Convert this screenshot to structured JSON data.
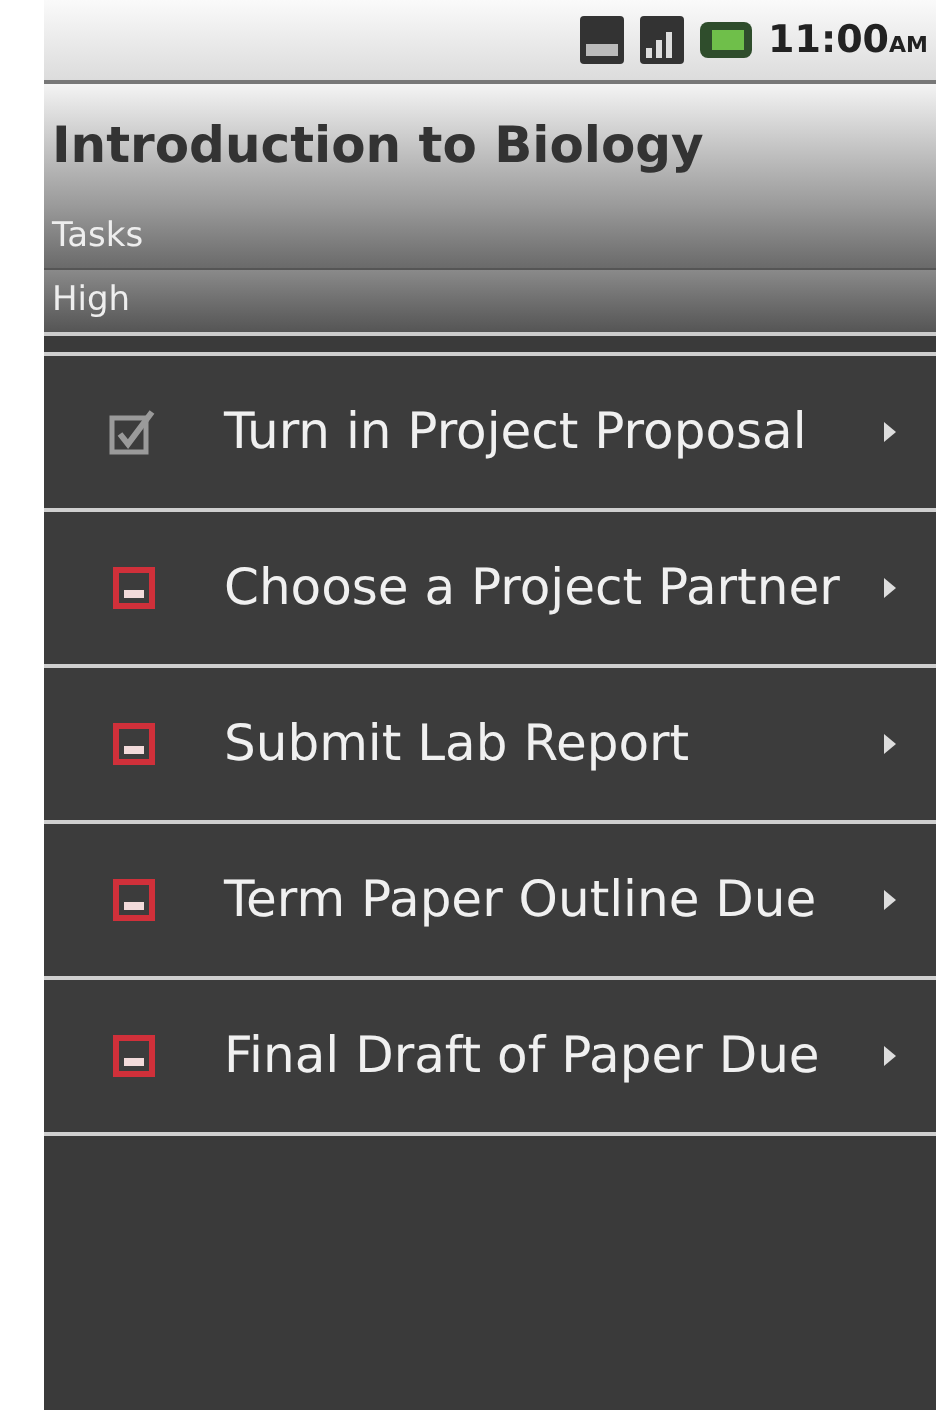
{
  "status_bar": {
    "time": "11:00",
    "time_suffix": "AM"
  },
  "header": {
    "title": "Introduction to Biology",
    "section": "Tasks",
    "group": "High"
  },
  "tasks": [
    {
      "label": "Turn in Project Proposal",
      "checked": true
    },
    {
      "label": "Choose a Project Partner",
      "checked": false
    },
    {
      "label": "Submit Lab Report",
      "checked": false
    },
    {
      "label": "Term Paper Outline Due",
      "checked": false
    },
    {
      "label": "Final Draft of Paper Due",
      "checked": false
    }
  ]
}
